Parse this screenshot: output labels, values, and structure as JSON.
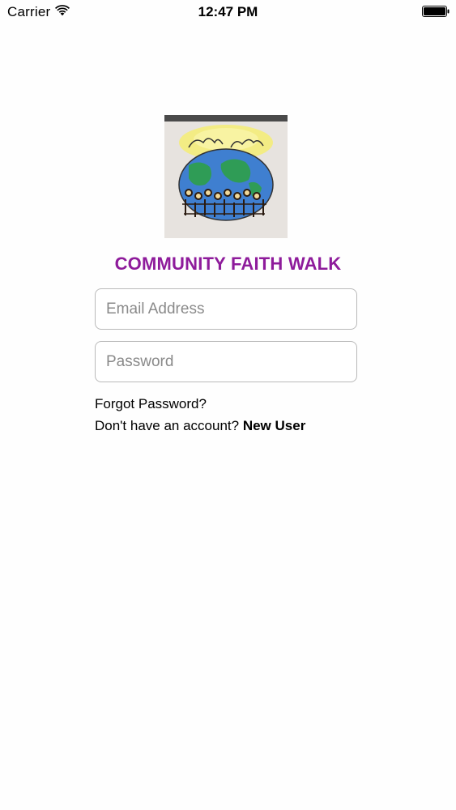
{
  "status_bar": {
    "carrier": "Carrier",
    "time": "12:47 PM",
    "wifi_icon": "wifi-icon",
    "battery_icon": "battery-icon"
  },
  "logo": {
    "icon": "globe-with-hands-logo"
  },
  "title": "COMMUNITY FAITH WALK",
  "form": {
    "email_placeholder": "Email Address",
    "email_value": "",
    "password_placeholder": "Password",
    "password_value": ""
  },
  "links": {
    "forgot_password": "Forgot Password?",
    "no_account_prompt": "Don't have an account?",
    "new_user": "New User"
  },
  "colors": {
    "title": "#8e1b9b",
    "field_border": "#b9b9b9",
    "placeholder": "#8a8a8a"
  }
}
